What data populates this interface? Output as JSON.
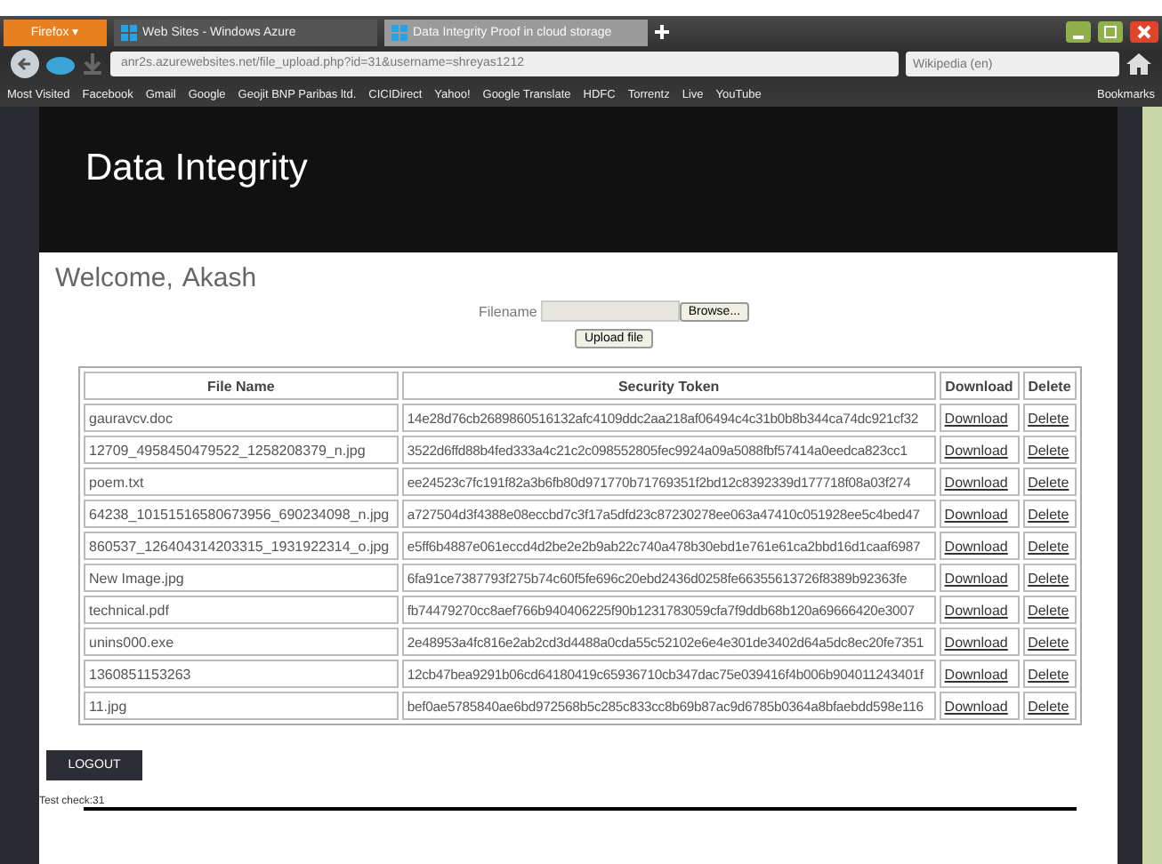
{
  "browser": {
    "menu_button": "Firefox ▾",
    "tabs": [
      {
        "title": "Web Sites - Windows Azure",
        "selected": false
      },
      {
        "title": "Data Integrity Proof in cloud storage",
        "selected": true
      }
    ],
    "url": "anr2s.azurewebsites.net/file_upload.php?id=31&username=shreyas1212",
    "search_placeholder": "Wikipedia (en)",
    "bookmarks": [
      "Most Visited",
      "Facebook",
      "Gmail",
      "Google",
      "Geojit BNP Paribas ltd.",
      "CICIDirect",
      "Yahoo!",
      "Google Translate",
      "HDFC",
      "Torrentz",
      "Live",
      "YouTube"
    ],
    "bookmarks_menu": "Bookmarks"
  },
  "header": {
    "title": "Data Integrity"
  },
  "welcome": {
    "greeting": "Welcome,",
    "user": "Akash"
  },
  "upload": {
    "label": "Filename",
    "browse": "Browse...",
    "submit": "Upload file"
  },
  "table": {
    "columns": [
      "File Name",
      "Security Token",
      "Download",
      "Delete"
    ],
    "rows": [
      {
        "file": "gauravcv.doc",
        "token": "14e28d76cb2689860516132afc4109ddc2aa218af06494c4c31b0b8b344ca74dc921cf32",
        "download": "Download",
        "delete": "Delete"
      },
      {
        "file": "12709_4958450479522_1258208379_n.jpg",
        "token": "3522d6ffd88b4fed333a4c21c2c098552805fec9924a09a5088fbf57414a0eedca823cc1",
        "download": "Download",
        "delete": "Delete"
      },
      {
        "file": "poem.txt",
        "token": "ee24523c7fc191f82a3b6fb80d971770b71769351f2bd12c8392339d177718f08a03f274",
        "download": "Download",
        "delete": "Delete"
      },
      {
        "file": "64238_10151516580673956_690234098_n.jpg",
        "token": "a727504d3f4388e08eccbd7c3f17a5dfd23c87230278ee063a47410c051928ee5c4bed47",
        "download": "Download",
        "delete": "Delete"
      },
      {
        "file": "860537_126404314203315_1931922314_o.jpg",
        "token": "e5ff6b4887e061eccd4d2be2e2b9ab22c740a478b30ebd1e761e61ca2bbd16d1caaf6987",
        "download": "Download",
        "delete": "Delete"
      },
      {
        "file": "New Image.jpg",
        "token": "6fa91ce7387793f275b74c60f5fe696c20ebd2436d0258fe66355613726f8389b92363fe",
        "download": "Download",
        "delete": "Delete"
      },
      {
        "file": "technical.pdf",
        "token": "fb74479270cc8aef766b940406225f90b1231783059cfa7f9ddb68b120a69666420e3007",
        "download": "Download",
        "delete": "Delete"
      },
      {
        "file": "unins000.exe",
        "token": "2e48953a4fc816e2ab2cd3d4488a0cda55c52102e6e4e301de3402d64a5dc8ec20fe7351",
        "download": "Download",
        "delete": "Delete"
      },
      {
        "file": "1360851153263",
        "token": "12cb47bea9291b06cd64180419c65936710cb347dac75e039416f4b006b904011243401f",
        "download": "Download",
        "delete": "Delete"
      },
      {
        "file": "11.jpg",
        "token": "bef0ae5785840ae6bd972568b5c285c833cc8b69b87ac9d6785b0364a8bfaebdd598e116",
        "download": "Download",
        "delete": "Delete"
      }
    ]
  },
  "logout": "LOGOUT",
  "footer_note": "Test check:31"
}
